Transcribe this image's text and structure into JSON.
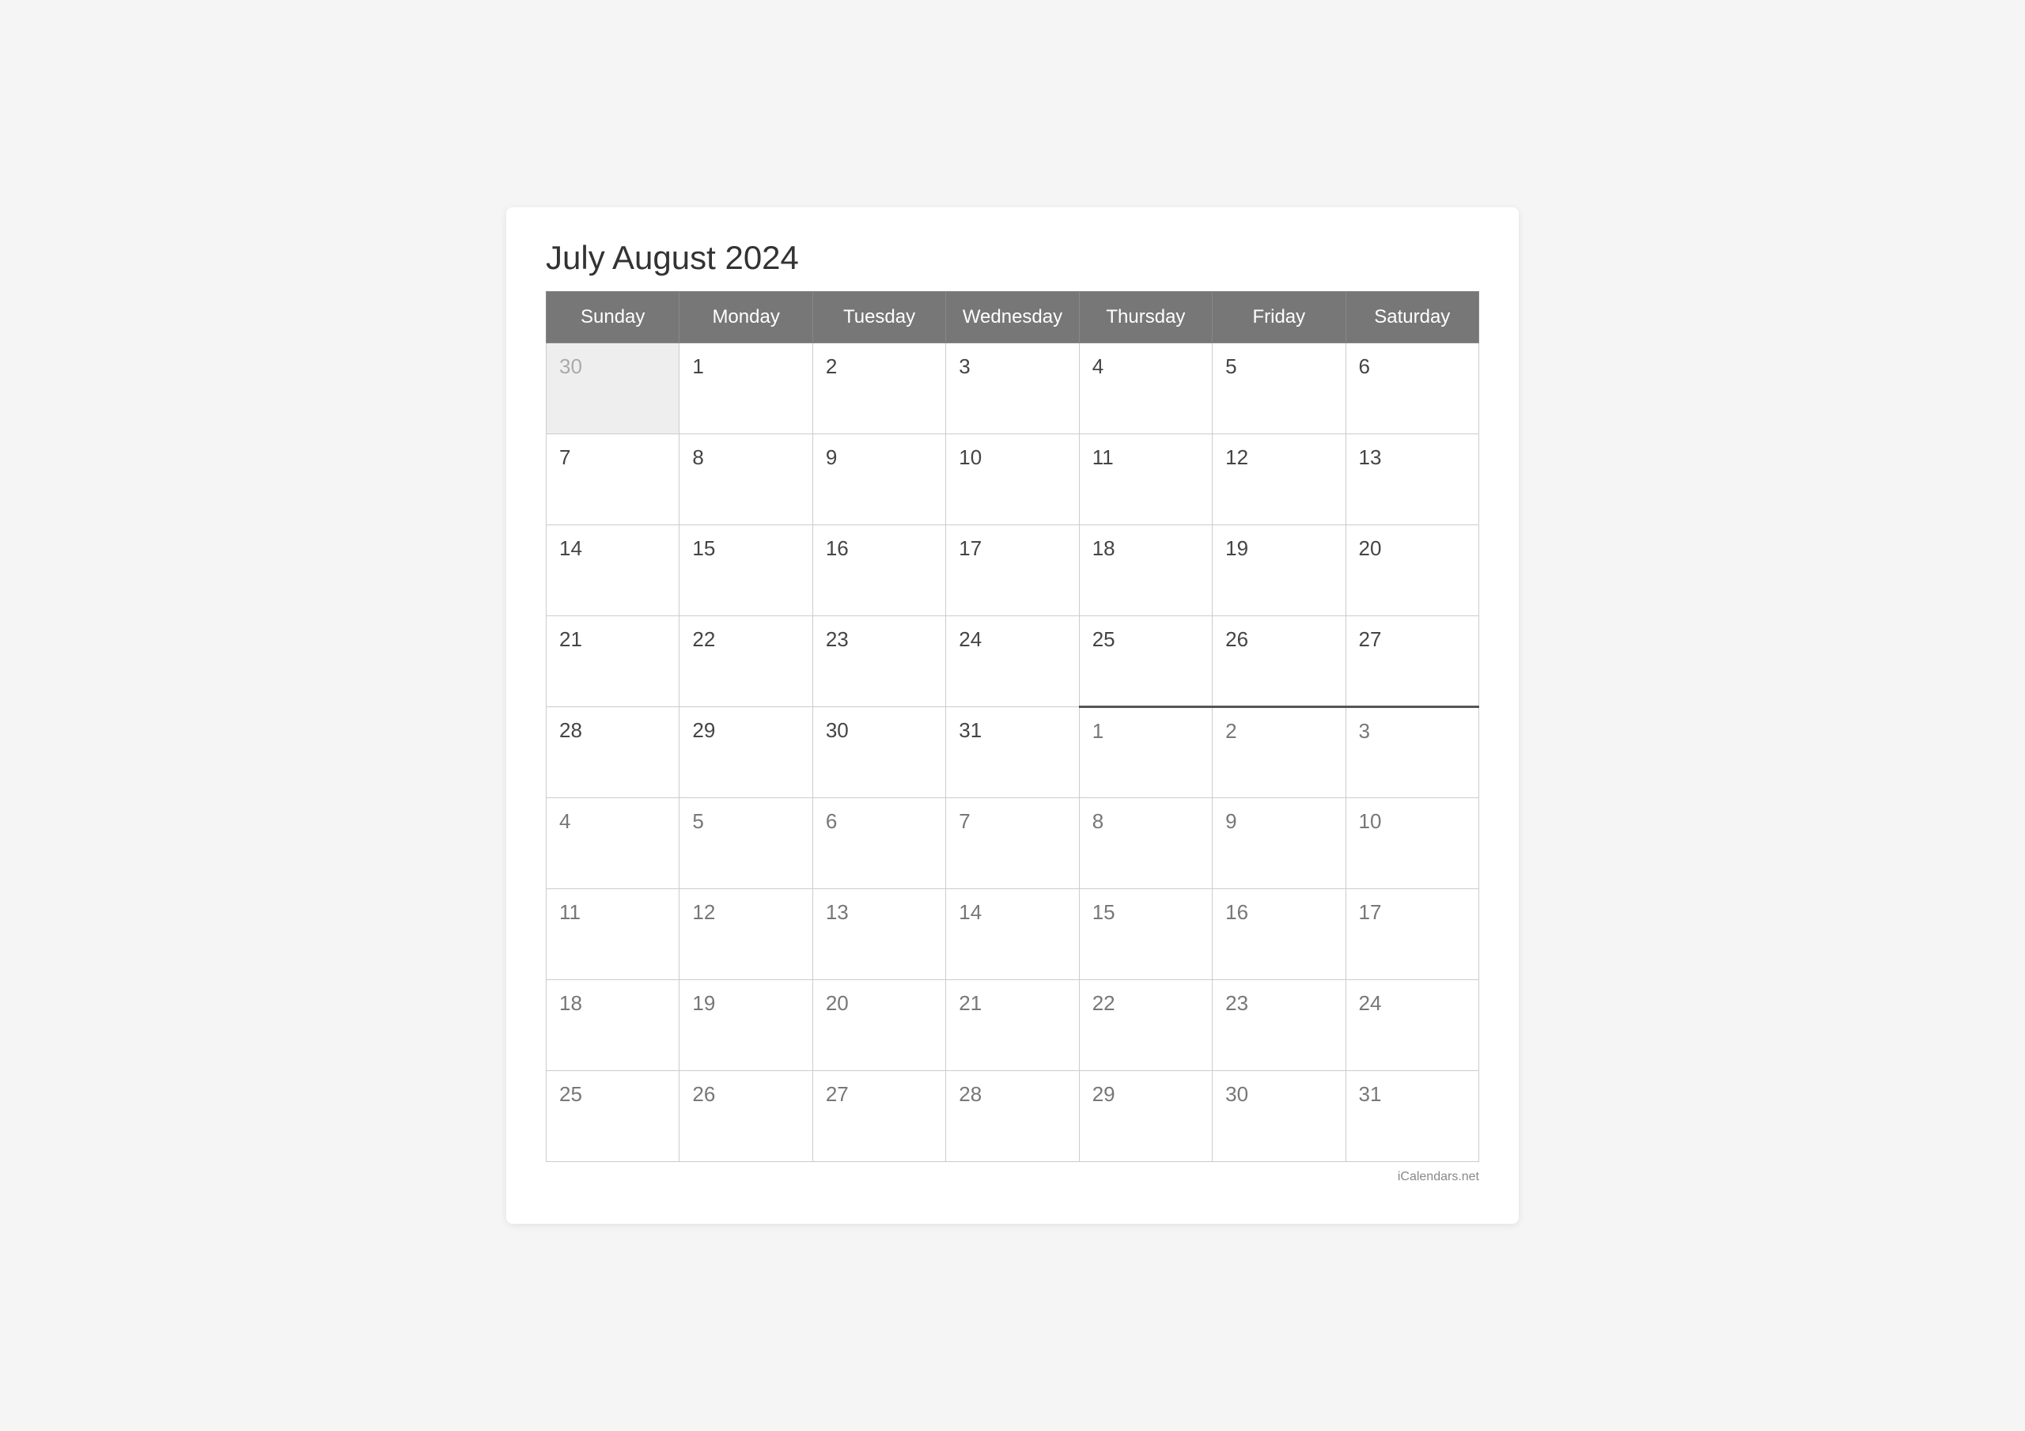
{
  "title": "July August 2024",
  "days_of_week": [
    "Sunday",
    "Monday",
    "Tuesday",
    "Wednesday",
    "Thursday",
    "Friday",
    "Saturday"
  ],
  "weeks": [
    [
      {
        "date": "30",
        "type": "prev-month"
      },
      {
        "date": "1",
        "type": "current"
      },
      {
        "date": "2",
        "type": "current"
      },
      {
        "date": "3",
        "type": "current"
      },
      {
        "date": "4",
        "type": "current"
      },
      {
        "date": "5",
        "type": "current"
      },
      {
        "date": "6",
        "type": "current"
      }
    ],
    [
      {
        "date": "7",
        "type": "current"
      },
      {
        "date": "8",
        "type": "current"
      },
      {
        "date": "9",
        "type": "current"
      },
      {
        "date": "10",
        "type": "current"
      },
      {
        "date": "11",
        "type": "current"
      },
      {
        "date": "12",
        "type": "current"
      },
      {
        "date": "13",
        "type": "current"
      }
    ],
    [
      {
        "date": "14",
        "type": "current"
      },
      {
        "date": "15",
        "type": "current"
      },
      {
        "date": "16",
        "type": "current"
      },
      {
        "date": "17",
        "type": "current"
      },
      {
        "date": "18",
        "type": "current"
      },
      {
        "date": "19",
        "type": "current"
      },
      {
        "date": "20",
        "type": "current"
      }
    ],
    [
      {
        "date": "21",
        "type": "current"
      },
      {
        "date": "22",
        "type": "current"
      },
      {
        "date": "23",
        "type": "current"
      },
      {
        "date": "24",
        "type": "current"
      },
      {
        "date": "25",
        "type": "current"
      },
      {
        "date": "26",
        "type": "current"
      },
      {
        "date": "27",
        "type": "current"
      }
    ],
    [
      {
        "date": "28",
        "type": "current"
      },
      {
        "date": "29",
        "type": "current"
      },
      {
        "date": "30",
        "type": "current"
      },
      {
        "date": "31",
        "type": "current"
      },
      {
        "date": "1",
        "type": "next-month",
        "divider": true
      },
      {
        "date": "2",
        "type": "next-month",
        "divider": true
      },
      {
        "date": "3",
        "type": "next-month",
        "divider": true
      }
    ],
    [
      {
        "date": "4",
        "type": "next-month"
      },
      {
        "date": "5",
        "type": "next-month"
      },
      {
        "date": "6",
        "type": "next-month"
      },
      {
        "date": "7",
        "type": "next-month"
      },
      {
        "date": "8",
        "type": "next-month"
      },
      {
        "date": "9",
        "type": "next-month"
      },
      {
        "date": "10",
        "type": "next-month"
      }
    ],
    [
      {
        "date": "11",
        "type": "next-month"
      },
      {
        "date": "12",
        "type": "next-month"
      },
      {
        "date": "13",
        "type": "next-month"
      },
      {
        "date": "14",
        "type": "next-month"
      },
      {
        "date": "15",
        "type": "next-month"
      },
      {
        "date": "16",
        "type": "next-month"
      },
      {
        "date": "17",
        "type": "next-month"
      }
    ],
    [
      {
        "date": "18",
        "type": "next-month"
      },
      {
        "date": "19",
        "type": "next-month"
      },
      {
        "date": "20",
        "type": "next-month"
      },
      {
        "date": "21",
        "type": "next-month"
      },
      {
        "date": "22",
        "type": "next-month"
      },
      {
        "date": "23",
        "type": "next-month"
      },
      {
        "date": "24",
        "type": "next-month"
      }
    ],
    [
      {
        "date": "25",
        "type": "next-month"
      },
      {
        "date": "26",
        "type": "next-month"
      },
      {
        "date": "27",
        "type": "next-month"
      },
      {
        "date": "28",
        "type": "next-month"
      },
      {
        "date": "29",
        "type": "next-month"
      },
      {
        "date": "30",
        "type": "next-month"
      },
      {
        "date": "31",
        "type": "next-month"
      }
    ]
  ],
  "footer": "iCalendars.net"
}
